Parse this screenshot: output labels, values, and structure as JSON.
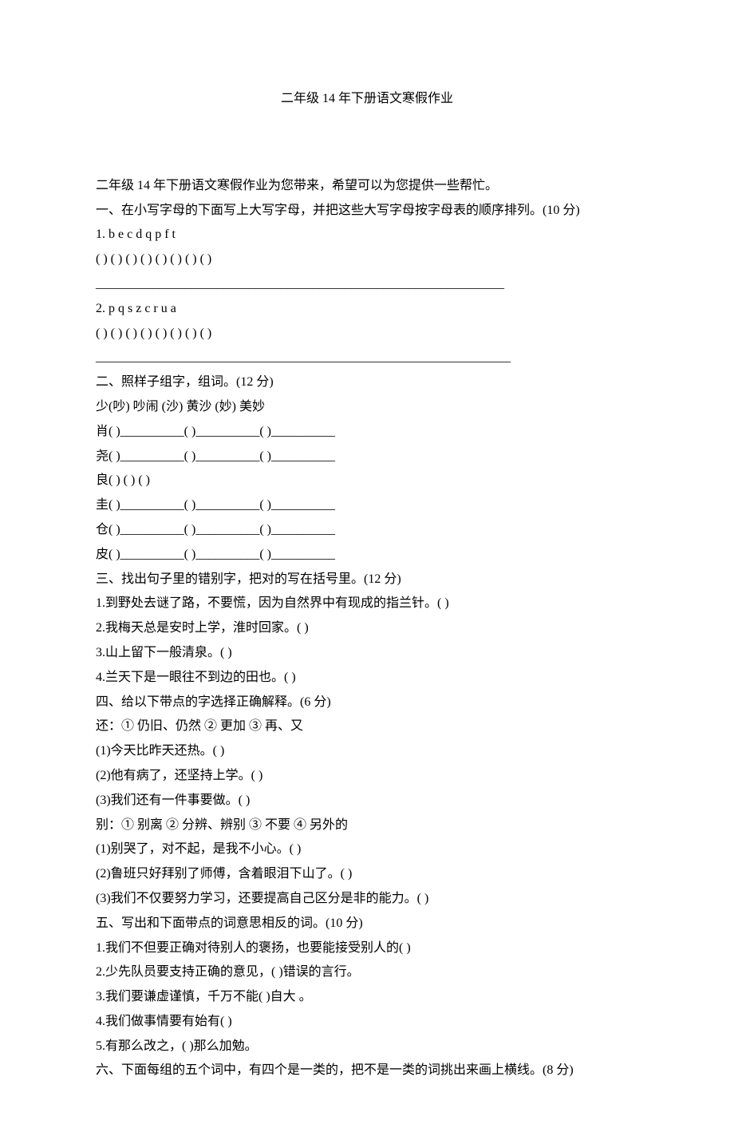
{
  "title": "二年级 14 年下册语文寒假作业",
  "intro": "二年级 14 年下册语文寒假作业为您带来，希望可以为您提供一些帮忙。",
  "section1_heading": "一、在小写字母的下面写上大写字母，并把这些大写字母按字母表的顺序排列。(10 分)",
  "s1_q1_label": "1. b e c d q p f t",
  "s1_brackets": "( ) ( ) ( ) ( ) ( ) ( ) ( ) ( )",
  "s1_rule1": "________________________________________________________________",
  "s1_q2_label": "2. p q s z c r u a",
  "s1_rule2": "_________________________________________________________________",
  "section2_heading": "二、照样子组字，组词。(12 分)",
  "s2_example": "少(吵) 吵闹 (沙) 黄沙 (妙) 美妙",
  "s2_line_xiao": "肖( )__________( )__________( )__________",
  "s2_line_yao": "尧( )__________( )__________( )__________",
  "s2_line_liang": "良( ) ( ) ( )",
  "s2_line_gui": "圭( )__________( )__________( )__________",
  "s2_line_cang": "仓( )__________( )__________( )__________",
  "s2_line_pi": "皮( )__________( )__________( )__________",
  "section3_heading": "三、找出句子里的错别字，把对的写在括号里。(12 分)",
  "s3_q1": "1.到野处去谜了路，不要慌，因为自然界中有现成的指兰针。( )",
  "s3_q2": "2.我梅天总是安时上学，淮时回家。( )",
  "s3_q3": "3.山上留下一般清泉。( )",
  "s3_q4": "4.兰天下是一眼往不到边的田也。( )",
  "section4_heading": "四、给以下带点的字选择正确解释。(6 分)",
  "s4_hai_def": "还：① 仍旧、仍然 ② 更加 ③ 再、又",
  "s4_hai_1": "(1)今天比昨天还热。( )",
  "s4_hai_2": "(2)他有病了，还坚持上学。( )",
  "s4_hai_3": "(3)我们还有一件事要做。( )",
  "s4_bie_def": "别：① 别离 ② 分辨、辨别 ③ 不要 ④ 另外的",
  "s4_bie_1": "(1)别哭了，对不起，是我不小心。( )",
  "s4_bie_2": "(2)鲁班只好拜别了师傅，含着眼泪下山了。( )",
  "s4_bie_3": "(3)我们不仅要努力学习，还要提高自己区分是非的能力。( )",
  "section5_heading": "五、写出和下面带点的词意思相反的词。(10 分)",
  "s5_q1": "1.我们不但要正确对待别人的褒扬，也要能接受别人的( )",
  "s5_q2": "2.少先队员要支持正确的意见，( )错误的言行。",
  "s5_q3": "3.我们要谦虚谨慎，千万不能( )自大 。",
  "s5_q4": "4.我们做事情要有始有( )",
  "s5_q5": "5.有那么改之，( )那么加勉。",
  "section6_heading": "六、下面每组的五个词中，有四个是一类的，把不是一类的词挑出来画上横线。(8 分)"
}
